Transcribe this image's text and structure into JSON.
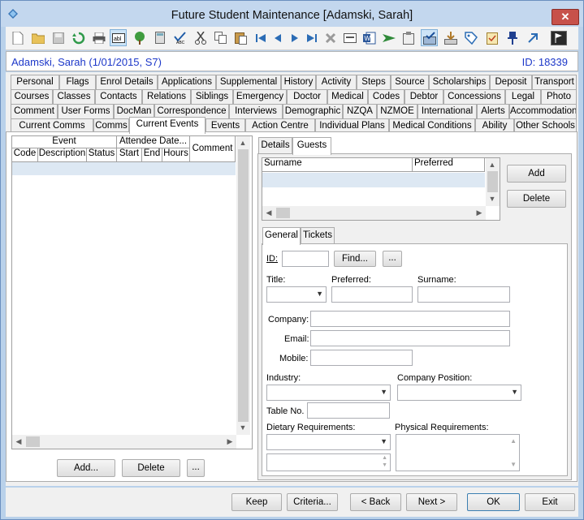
{
  "window": {
    "title": "Future Student Maintenance  [Adamski, Sarah]",
    "close_glyph": "✕"
  },
  "toolbar": {
    "icons": [
      "new-icon",
      "open-folder-icon",
      "save-icon",
      "refresh-icon",
      "print-icon",
      "text-field-icon",
      "tree-icon",
      "calculator-icon",
      "spell-check-icon",
      "cut-icon",
      "copy-icon",
      "paste-icon",
      "first-record-icon",
      "previous-record-icon",
      "next-record-icon",
      "last-record-icon",
      "delete-icon",
      "card-icon",
      "word-icon",
      "send-icon",
      "clipboard-icon",
      "approve-icon",
      "import-icon",
      "tag-icon",
      "checklist-icon",
      "pin-icon",
      "arrow-up-right-icon",
      "flag-icon"
    ]
  },
  "student": {
    "summary": "Adamski, Sarah (1/01/2015, S7)",
    "id_text": "ID: 18339"
  },
  "tabs": {
    "row1": [
      "Personal",
      "Flags",
      "Enrol Details",
      "Applications",
      "Supplemental",
      "History",
      "Activity",
      "Steps",
      "Source",
      "Scholarships",
      "Deposit",
      "Transport"
    ],
    "row2": [
      "Courses",
      "Classes",
      "Contacts",
      "Relations",
      "Siblings",
      "Emergency",
      "Doctor",
      "Medical",
      "Codes",
      "Debtor",
      "Concessions",
      "Legal",
      "Photo"
    ],
    "row3": [
      "Comment",
      "User Forms",
      "DocMan",
      "Correspondence",
      "Interviews",
      "Demographic",
      "NZQA",
      "NZMOE",
      "International",
      "Alerts",
      "Accommodation"
    ],
    "row4": [
      "Current Comms",
      "Comms",
      "Current Events",
      "Events",
      "Action Centre",
      "Individual Plans",
      "Medical Conditions",
      "Ability",
      "Other Schools"
    ],
    "active": "Current Events"
  },
  "events_grid": {
    "group_event": "Event",
    "group_attendee": "Attendee Date...",
    "columns": [
      "Code",
      "Description",
      "Status",
      "Start",
      "End",
      "Hours",
      "Comment"
    ]
  },
  "event_buttons": {
    "add": "Add...",
    "delete": "Delete",
    "more": "..."
  },
  "right_tabs": {
    "details": "Details",
    "guests": "Guests"
  },
  "guests_grid": {
    "columns": [
      "Surname",
      "Preferred"
    ]
  },
  "guest_buttons": {
    "add": "Add",
    "delete": "Delete"
  },
  "guest_subtabs": {
    "general": "General",
    "tickets": "Tickets"
  },
  "form": {
    "id_label": "ID:",
    "find": "Find...",
    "more": "...",
    "title_label": "Title:",
    "preferred_label": "Preferred:",
    "surname_label": "Surname:",
    "company_label": "Company:",
    "email_label": "Email:",
    "mobile_label": "Mobile:",
    "industry_label": "Industry:",
    "company_position_label": "Company Position:",
    "table_no_label": "Table No.",
    "dietary_label": "Dietary Requirements:",
    "physical_label": "Physical Requirements:"
  },
  "footer": {
    "keep": "Keep",
    "criteria": "Criteria...",
    "back": "< Back",
    "next": "Next >",
    "ok": "OK",
    "exit": "Exit"
  }
}
